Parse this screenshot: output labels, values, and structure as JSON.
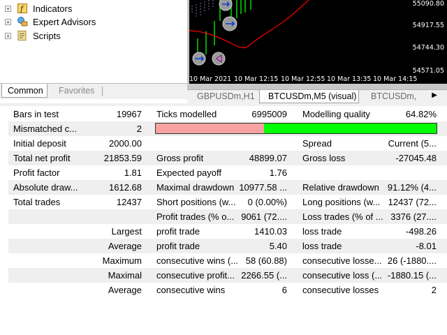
{
  "navigator": {
    "items": [
      {
        "label": "Indicators",
        "icon": "indicators-icon"
      },
      {
        "label": "Expert Advisors",
        "icon": "expert-advisors-icon"
      },
      {
        "label": "Scripts",
        "icon": "scripts-icon"
      }
    ],
    "tabs": {
      "active": "Common",
      "inactive": "Favorites"
    }
  },
  "chart": {
    "price_labels": [
      "55090.80",
      "54917.55",
      "54744.30",
      "54571.05"
    ],
    "time_labels": [
      "10 Mar 2021",
      "10 Mar 12:15",
      "10 Mar 12:55",
      "10 Mar 13:35",
      "10 Mar 14:15"
    ],
    "colors": {
      "background": "#000000",
      "bars": "#00ff00",
      "moving_average": "#ff0000",
      "grid": "#6e7aa8"
    }
  },
  "chart_tabs": [
    "GBPUSDm,H1",
    "BTCUSDm,M5 (visual)",
    "BTCUSDm,"
  ],
  "report": {
    "mismatch_fraction": 0.3847,
    "rows": [
      {
        "l1": "Bars in test",
        "v1": "19967",
        "l2": "Ticks modelled",
        "v2": "6995009",
        "l3": "Modelling quality",
        "v3": "64.82%"
      },
      {
        "l1": "Mismatched c...",
        "v1": "2",
        "bar": true
      },
      {
        "l1": "Initial deposit",
        "v1": "2000.00",
        "l2": "",
        "v2": "",
        "l3": "Spread",
        "v3": "Current (5..."
      },
      {
        "l1": "Total net profit",
        "v1": "21853.59",
        "l2": "Gross profit",
        "v2": "48899.07",
        "l3": "Gross loss",
        "v3": "-27045.48"
      },
      {
        "l1": "Profit factor",
        "v1": "1.81",
        "l2": "Expected payoff",
        "v2": "1.76",
        "l3": "",
        "v3": ""
      },
      {
        "l1": "Absolute draw...",
        "v1": "1612.68",
        "l2": "Maximal drawdown",
        "v2": "10977.58 ...",
        "l3": "Relative drawdown",
        "v3": "91.12% (4..."
      },
      {
        "l1": "Total trades",
        "v1": "12437",
        "l2": "Short positions (w...",
        "v2": "0 (0.00%)",
        "l3": "Long positions (w...",
        "v3": "12437 (72..."
      },
      {
        "l1": "",
        "v1": "",
        "l2": "Profit trades (% o...",
        "v2": "9061 (72....",
        "l3": "Loss trades (% of ...",
        "v3": "3376 (27...."
      },
      {
        "l1": "",
        "v1": "Largest",
        "l2": "profit trade",
        "v2": "1410.03",
        "l3": "loss trade",
        "v3": "-498.26"
      },
      {
        "l1": "",
        "v1": "Average",
        "l2": "profit trade",
        "v2": "5.40",
        "l3": "loss trade",
        "v3": "-8.01"
      },
      {
        "l1": "",
        "v1": "Maximum",
        "l2": "consecutive wins (...",
        "v2": "58 (60.88)",
        "l3": "consecutive losse...",
        "v3": "26 (-1880...."
      },
      {
        "l1": "",
        "v1": "Maximal",
        "l2": "consecutive profit...",
        "v2": "2266.55 (...",
        "l3": "consecutive loss (...",
        "v3": "-1880.15 (..."
      },
      {
        "l1": "",
        "v1": "Average",
        "l2": "consecutive wins",
        "v2": "6",
        "l3": "consecutive losses",
        "v3": "2"
      }
    ]
  }
}
